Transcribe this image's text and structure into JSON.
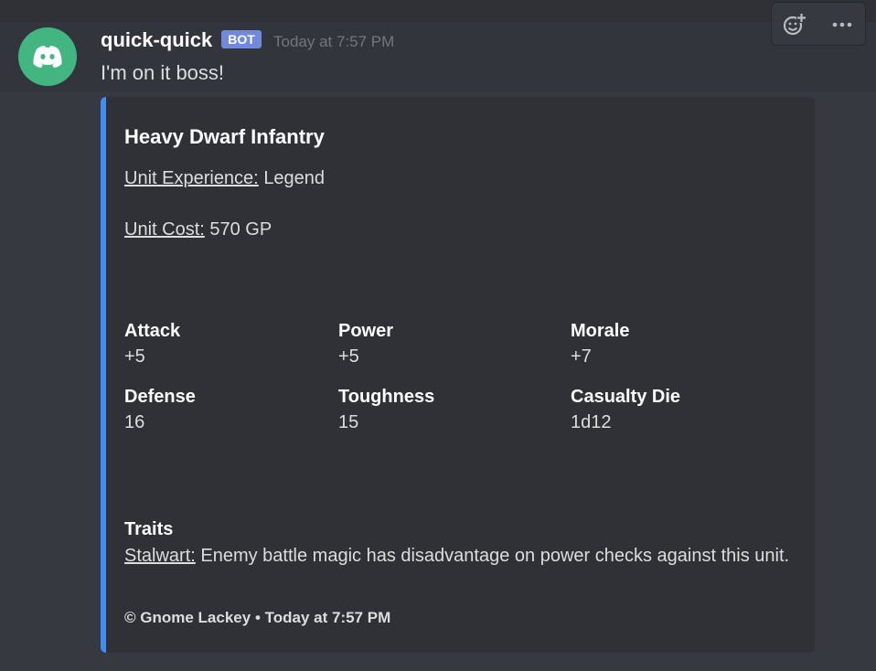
{
  "colors": {
    "background": "#36393f",
    "message_hover": "#32353b",
    "embed_background": "#2f3136",
    "embed_accent": "#3e8ef3",
    "avatar": "#43b581",
    "bot_badge": "#7289da",
    "timestamp": "#72767d"
  },
  "message": {
    "avatar_icon": "discord-logo-icon",
    "username": "quick-quick",
    "badge": "BOT",
    "timestamp": "Today at 7:57 PM",
    "text": "I'm on it boss!"
  },
  "actions": {
    "add_reaction_icon": "add-reaction-icon",
    "more_icon": "more-options-icon"
  },
  "embed": {
    "title": "Heavy Dwarf Infantry",
    "experience_label": "Unit Experience:",
    "experience_value": "Legend",
    "cost_label": "Unit Cost:",
    "cost_value": "570 GP",
    "fields": [
      {
        "name": "Attack",
        "value": "+5"
      },
      {
        "name": "Power",
        "value": "+5"
      },
      {
        "name": "Morale",
        "value": "+7"
      },
      {
        "name": "Defense",
        "value": "16"
      },
      {
        "name": "Toughness",
        "value": "15"
      },
      {
        "name": "Casualty Die",
        "value": "1d12"
      }
    ],
    "traits_title": "Traits",
    "trait_name": "Stalwart:",
    "trait_text": "Enemy battle magic has disadvantage on power checks against this unit.",
    "footer_author": "© Gnome Lackey",
    "footer_separator": "•",
    "footer_time": "Today at 7:57 PM"
  }
}
